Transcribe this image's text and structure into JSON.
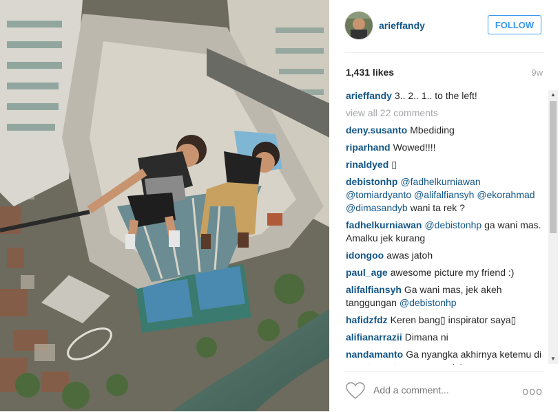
{
  "post": {
    "username": "arieffandy",
    "follow_label": "FOLLOW",
    "likes": "1,431 likes",
    "time_ago": "9w"
  },
  "comments": [
    {
      "author": "arieffandy",
      "parts": [
        {
          "t": "3.. 2.. 1.. to the left!"
        }
      ]
    },
    {
      "viewall": "view all 22 comments"
    },
    {
      "author": "deny.susanto",
      "parts": [
        {
          "t": "Mbediding"
        }
      ]
    },
    {
      "author": "riparhand",
      "parts": [
        {
          "t": "Wowed!!!!"
        }
      ]
    },
    {
      "author": "rinaldyed",
      "parts": [
        {
          "t": "▯"
        }
      ]
    },
    {
      "author": "debistonhp",
      "parts": [
        {
          "m": "@fadhelkurniawan"
        },
        {
          "t": " "
        },
        {
          "m": "@tomiardyanto"
        },
        {
          "t": " "
        },
        {
          "m": "@alifalfiansyh"
        },
        {
          "t": " "
        },
        {
          "m": "@ekorahmad"
        },
        {
          "t": " "
        },
        {
          "m": "@dimasandyb"
        },
        {
          "t": " wani ta rek ?"
        }
      ]
    },
    {
      "author": "fadhelkurniawan",
      "parts": [
        {
          "m": "@debistonhp"
        },
        {
          "t": " ga wani mas. Amalku jek kurang"
        }
      ]
    },
    {
      "author": "idongoo",
      "parts": [
        {
          "t": "awas jatoh"
        }
      ]
    },
    {
      "author": "paul_age",
      "parts": [
        {
          "t": "awesome picture my friend :)"
        }
      ]
    },
    {
      "author": "alifalfiansyh",
      "parts": [
        {
          "t": "Ga wani mas, jek akeh tanggungan "
        },
        {
          "m": "@debistonhp"
        }
      ]
    },
    {
      "author": "hafidzfdz",
      "parts": [
        {
          "t": "Keren bang▯ inspirator saya▯"
        }
      ]
    },
    {
      "author": "alifianarrazii",
      "parts": [
        {
          "t": "Dimana ni"
        }
      ]
    },
    {
      "author": "nandamanto",
      "parts": [
        {
          "t": "Ga nyangka akhirnya ketemu di satu tempat sama orang ini"
        }
      ]
    }
  ],
  "footer": {
    "comment_placeholder": "Add a comment...",
    "more_label": "ooo"
  },
  "icons": {
    "heart": "heart-outline-icon",
    "more": "more-options-icon",
    "scroll_up": "scroll-up-arrow",
    "scroll_down": "scroll-down-arrow"
  },
  "colors": {
    "username_link": "#125688",
    "follow_blue": "#3897f0",
    "muted": "#a5a7aa",
    "divider": "#efefef"
  }
}
